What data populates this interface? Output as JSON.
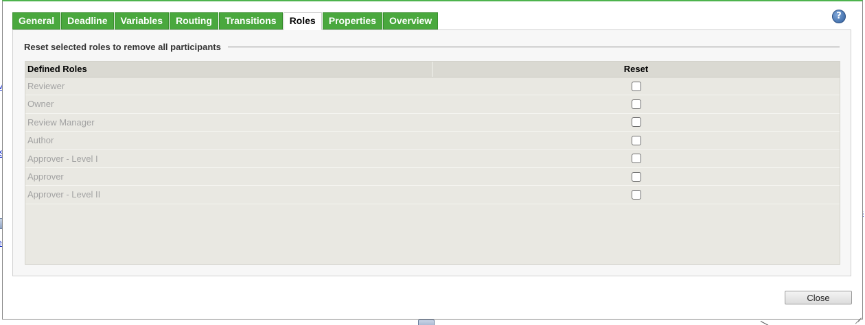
{
  "help": {
    "icon": "help-icon",
    "glyph": "?"
  },
  "tabs": [
    {
      "label": "General",
      "active": false
    },
    {
      "label": "Deadline",
      "active": false
    },
    {
      "label": "Variables",
      "active": false
    },
    {
      "label": "Routing",
      "active": false
    },
    {
      "label": "Transitions",
      "active": false
    },
    {
      "label": "Roles",
      "active": true
    },
    {
      "label": "Properties",
      "active": false
    },
    {
      "label": "Overview",
      "active": false
    }
  ],
  "roles_panel": {
    "legend": "Reset selected roles to remove all participants",
    "columns": [
      "Defined Roles",
      "Reset"
    ],
    "rows": [
      {
        "role": "Reviewer",
        "reset": false
      },
      {
        "role": "Owner",
        "reset": false
      },
      {
        "role": "Review Manager",
        "reset": false
      },
      {
        "role": "Author",
        "reset": false
      },
      {
        "role": "Approver - Level I",
        "reset": false
      },
      {
        "role": "Approver",
        "reset": false
      },
      {
        "role": "Approver - Level II",
        "reset": false
      }
    ]
  },
  "footer": {
    "close_label": "Close"
  },
  "background": {
    "fragments": [
      "v",
      "S",
      "s",
      "es"
    ]
  },
  "colors": {
    "tab_green": "#4aa83e",
    "dialog_top_border": "#4db34d",
    "grid_bg": "#e9e8e2"
  }
}
